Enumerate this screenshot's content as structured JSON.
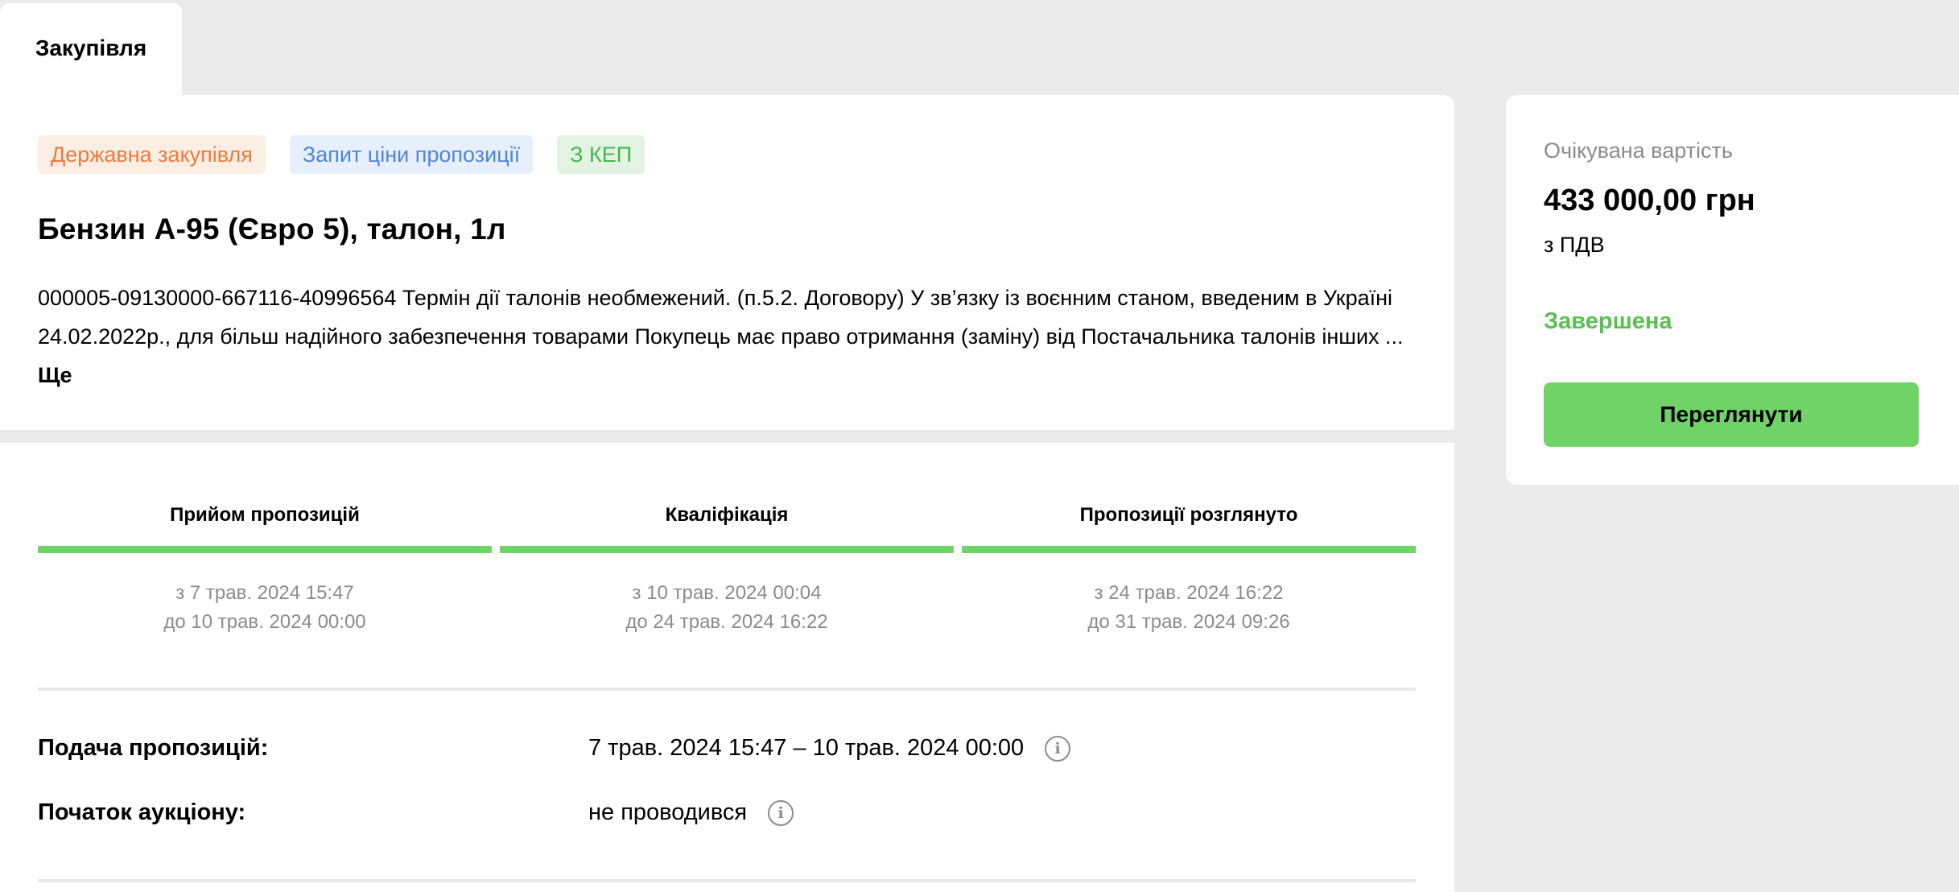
{
  "tab": {
    "label": "Закупівля"
  },
  "tender": {
    "badges": {
      "type": "Державна закупівля",
      "method": "Запит ціни пропозиції",
      "kep": "З КЕП"
    },
    "title": "Бензин А-95 (Євро 5), талон, 1л",
    "description": "000005-09130000-667116-40996564 Термін дії талонів необмежений. (п.5.2. Договору) У зв’язку із воєнним станом, введеним в Україні 24.02.2022р., для більш надійного забезпечення товарами Покупець має право отримання (заміну) від Постачальника талонів інших ...",
    "more_label": "Ще"
  },
  "stages": [
    {
      "label": "Прийом пропозицій",
      "from": "з 7 трав. 2024 15:47",
      "to": "до 10 трав. 2024 00:00"
    },
    {
      "label": "Кваліфікація",
      "from": "з 10 трав. 2024 00:04",
      "to": "до 24 трав. 2024 16:22"
    },
    {
      "label": "Пропозиції розглянуто",
      "from": "з 24 трав. 2024 16:22",
      "to": "до 31 трав. 2024 09:26"
    }
  ],
  "details": {
    "submission": {
      "label": "Подача пропозицій:",
      "value": "7 трав. 2024 15:47 – 10 трав. 2024 00:00"
    },
    "auction": {
      "label": "Початок аукціону:",
      "value": "не проводився"
    }
  },
  "summary": {
    "expected_label": "Очікувана вартість",
    "price": "433 000,00 грн",
    "vat": "з ПДВ",
    "status": "Завершена",
    "button_label": "Переглянути"
  },
  "colors": {
    "accent_green": "#6fd367",
    "status_green": "#5bbf52",
    "badge_orange": "#ef7a3a",
    "badge_blue": "#4e86d9"
  },
  "icons": {
    "info": "info-icon"
  }
}
